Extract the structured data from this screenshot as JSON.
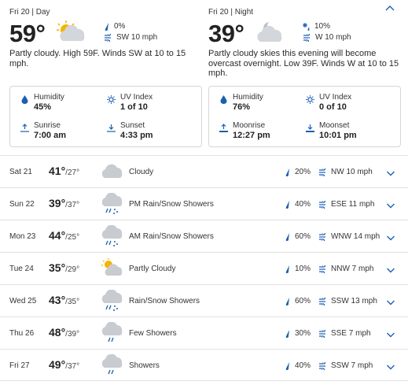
{
  "colors": {
    "accent": "#1a5fb4",
    "cloud": "#c8cbd0",
    "sun": "#f4b400"
  },
  "day": {
    "label": "Fri 20 | Day",
    "temp": "59°",
    "icon": "partly-cloudy-day-icon",
    "precip": "0%",
    "wind": "SW 10 mph",
    "description": "Partly cloudy. High 59F. Winds SW at 10 to 15 mph.",
    "details": {
      "humidity_label": "Humidity",
      "humidity": "45%",
      "uv_label": "UV Index",
      "uv": "1 of 10",
      "sunrise_label": "Sunrise",
      "sunrise": "7:00 am",
      "sunset_label": "Sunset",
      "sunset": "4:33 pm"
    }
  },
  "night": {
    "label": "Fri 20 | Night",
    "temp": "39°",
    "icon": "partly-cloudy-night-icon",
    "precip": "10%",
    "wind": "W 10 mph",
    "description": "Partly cloudy skies this evening will become overcast overnight. Low 39F. Winds W at 10 to 15 mph.",
    "details": {
      "humidity_label": "Humidity",
      "humidity": "76%",
      "uv_label": "UV Index",
      "uv": "0 of 10",
      "moonrise_label": "Moonrise",
      "moonrise": "12:27 pm",
      "moonset_label": "Moonset",
      "moonset": "10:01 pm"
    }
  },
  "forecast": [
    {
      "day": "Sat 21",
      "high": "41°",
      "low": "/27°",
      "icon": "cloudy-icon",
      "condition": "Cloudy",
      "precip": "20%",
      "wind": "NW 10 mph"
    },
    {
      "day": "Sun 22",
      "high": "39°",
      "low": "/37°",
      "icon": "rain-snow-icon",
      "condition": "PM Rain/Snow Showers",
      "precip": "40%",
      "wind": "ESE 11 mph"
    },
    {
      "day": "Mon 23",
      "high": "44°",
      "low": "/25°",
      "icon": "rain-snow-icon",
      "condition": "AM Rain/Snow Showers",
      "precip": "60%",
      "wind": "WNW 14 mph"
    },
    {
      "day": "Tue 24",
      "high": "35°",
      "low": "/29°",
      "icon": "partly-cloudy-day-icon",
      "condition": "Partly Cloudy",
      "precip": "10%",
      "wind": "NNW 7 mph"
    },
    {
      "day": "Wed 25",
      "high": "43°",
      "low": "/35°",
      "icon": "rain-snow-icon",
      "condition": "Rain/Snow Showers",
      "precip": "60%",
      "wind": "SSW 13 mph"
    },
    {
      "day": "Thu 26",
      "high": "48°",
      "low": "/39°",
      "icon": "showers-icon",
      "condition": "Few Showers",
      "precip": "30%",
      "wind": "SSE 7 mph"
    },
    {
      "day": "Fri 27",
      "high": "49°",
      "low": "/37°",
      "icon": "showers-icon",
      "condition": "Showers",
      "precip": "40%",
      "wind": "SSW 7 mph"
    }
  ]
}
